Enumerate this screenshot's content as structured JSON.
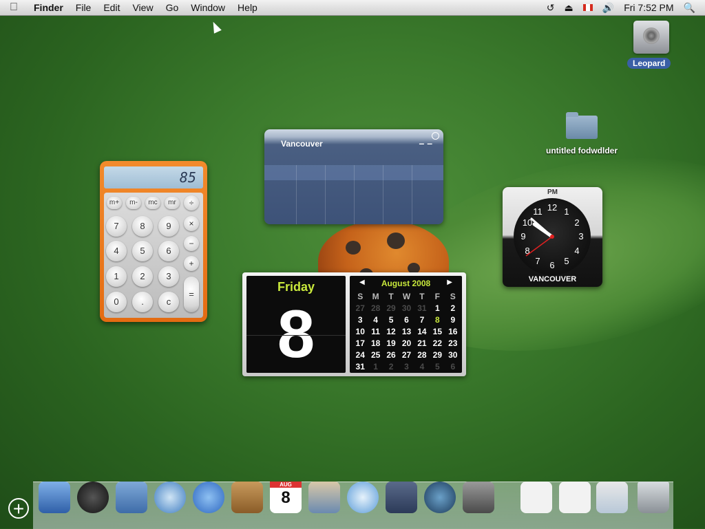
{
  "menubar": {
    "apple_icon": "apple-icon",
    "app_name": "Finder",
    "items": [
      "File",
      "Edit",
      "View",
      "Go",
      "Window",
      "Help"
    ],
    "clock": "Fri 7:52 PM",
    "status_icons": [
      "time-machine-icon",
      "eject-icon",
      "canada-flag-icon",
      "volume-icon",
      "spotlight-icon"
    ]
  },
  "desktop": {
    "hard_drive_label": "Leopard",
    "folder_label": "untitled fodwdlder"
  },
  "calculator": {
    "display": "85",
    "memory_keys": [
      "m+",
      "m-",
      "mc",
      "mr"
    ],
    "ops": [
      "÷",
      "×",
      "−",
      "+",
      "="
    ],
    "digits_rows": [
      [
        "7",
        "8",
        "9"
      ],
      [
        "4",
        "5",
        "6"
      ],
      [
        "1",
        "2",
        "3"
      ],
      [
        "0",
        ".",
        "c"
      ]
    ]
  },
  "weather": {
    "city": "Vancouver",
    "temp": "– –"
  },
  "clock": {
    "ampm": "PM",
    "city": "VANCOUVER",
    "numbers": [
      "12",
      "1",
      "2",
      "3",
      "4",
      "5",
      "6",
      "7",
      "8",
      "9",
      "10",
      "11"
    ]
  },
  "calendar": {
    "day_name": "Friday",
    "day_number": "8",
    "month_title": "August 2008",
    "weekday_headers": [
      "S",
      "M",
      "T",
      "W",
      "T",
      "F",
      "S"
    ],
    "weeks": [
      [
        "27",
        "28",
        "29",
        "30",
        "31",
        "1",
        "2"
      ],
      [
        "3",
        "4",
        "5",
        "6",
        "7",
        "8",
        "9"
      ],
      [
        "10",
        "11",
        "12",
        "13",
        "14",
        "15",
        "16"
      ],
      [
        "17",
        "18",
        "19",
        "20",
        "21",
        "22",
        "23"
      ],
      [
        "24",
        "25",
        "26",
        "27",
        "28",
        "29",
        "30"
      ],
      [
        "31",
        "1",
        "2",
        "3",
        "4",
        "5",
        "6"
      ]
    ]
  },
  "dock": {
    "add_widget": "+",
    "items": [
      "finder-icon",
      "dashboard-icon",
      "mail-icon",
      "safari-icon",
      "ichat-icon",
      "address-book-icon",
      "ical-icon",
      "iphoto-icon",
      "itunes-icon",
      "spaces-icon",
      "time-machine-icon",
      "system-preferences-icon",
      "pdf-document-icon",
      "pdf-document-icon",
      "screenshot-document-icon",
      "trash-icon"
    ],
    "ical_month": "AUG",
    "ical_day": "8"
  }
}
